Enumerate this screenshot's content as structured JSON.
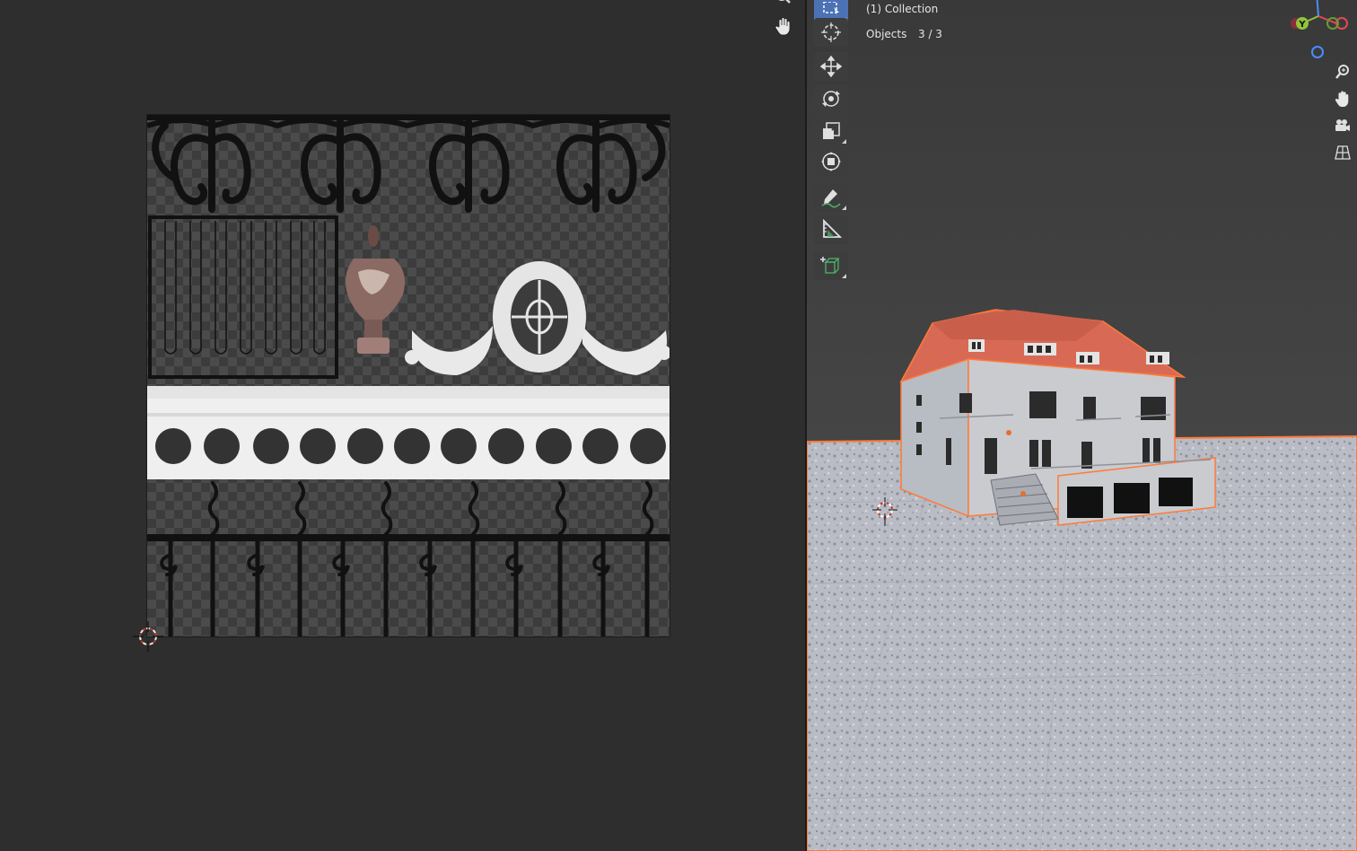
{
  "uv_editor": {
    "texture_rows": [
      "ornate iron scroll railing",
      "iron grille, vase finial, oval cartouche with swags",
      "white frieze with circular holes",
      "iron picket fence with spiral ornaments"
    ],
    "frieze_hole_count": 11
  },
  "viewport": {
    "collection_label": "(1) Collection",
    "objects_label": "Objects",
    "objects_count": "3 / 3",
    "gizmo_axes": [
      "Y",
      "X",
      "Z"
    ],
    "colors": {
      "selection_outline": "#ff7a3a",
      "roof": "#d86a55",
      "walls": "#c9cbcf",
      "ground": "#b8bcc5",
      "active_tool": "#4b72b5"
    }
  },
  "tools": [
    {
      "name": "select-box-tool",
      "icon": "select-box-icon",
      "active": true
    },
    {
      "name": "cursor-tool",
      "icon": "cursor-icon",
      "active": false
    },
    {
      "name": "move-tool",
      "icon": "move-icon",
      "active": false
    },
    {
      "name": "rotate-tool",
      "icon": "rotate-icon",
      "active": false
    },
    {
      "name": "scale-tool",
      "icon": "scale-icon",
      "active": false
    },
    {
      "name": "transform-tool",
      "icon": "transform-icon",
      "active": false
    },
    {
      "name": "annotate-tool",
      "icon": "annotate-icon",
      "active": false
    },
    {
      "name": "measure-tool",
      "icon": "measure-icon",
      "active": false
    },
    {
      "name": "add-cube-tool",
      "icon": "add-cube-icon",
      "active": false
    }
  ]
}
